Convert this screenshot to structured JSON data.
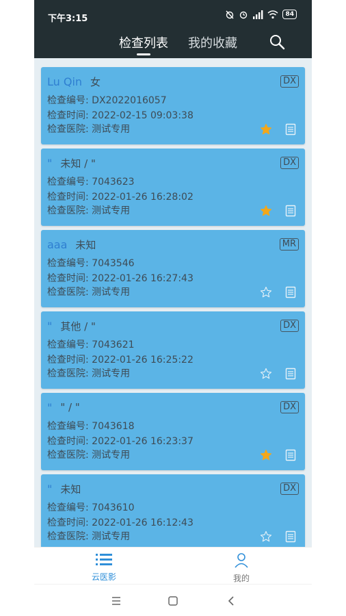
{
  "status_bar": {
    "time": "下午3:15",
    "battery": "84"
  },
  "header": {
    "tabs": [
      "检查列表",
      "我的收藏"
    ]
  },
  "labels": {
    "exam_no": "检查编号:",
    "exam_time": "检查时间:",
    "hospital": "检查医院:"
  },
  "records": [
    {
      "name": "Lu Qin",
      "info": "女",
      "modality": "DX",
      "id": "DX2022016057",
      "time": "2022-02-15 09:03:38",
      "hospital": "测试专用",
      "favorite": true
    },
    {
      "name": "\"",
      "info": "未知 / \"",
      "modality": "DX",
      "id": "7043623",
      "time": "2022-01-26 16:28:02",
      "hospital": "测试专用",
      "favorite": true
    },
    {
      "name": "aaa",
      "info": "未知",
      "modality": "MR",
      "id": "7043546",
      "time": "2022-01-26 16:27:43",
      "hospital": "测试专用",
      "favorite": false
    },
    {
      "name": "\"",
      "info": "其他 / \"",
      "modality": "DX",
      "id": "7043621",
      "time": "2022-01-26 16:25:22",
      "hospital": "测试专用",
      "favorite": false
    },
    {
      "name": "\"",
      "info": "\" / \"",
      "modality": "DX",
      "id": "7043618",
      "time": "2022-01-26 16:23:37",
      "hospital": "测试专用",
      "favorite": true
    },
    {
      "name": "\"",
      "info": "未知",
      "modality": "DX",
      "id": "7043610",
      "time": "2022-01-26 16:12:43",
      "hospital": "测试专用",
      "favorite": false
    }
  ],
  "bottom_nav": [
    {
      "label": "云医影",
      "icon": "list-icon"
    },
    {
      "label": "我的",
      "icon": "person-icon"
    }
  ],
  "colors": {
    "topbar": "#232f33",
    "card": "#5bb4e6",
    "name": "#2f7fd1",
    "star": "#f2a71b",
    "accent": "#2f8fd9"
  }
}
